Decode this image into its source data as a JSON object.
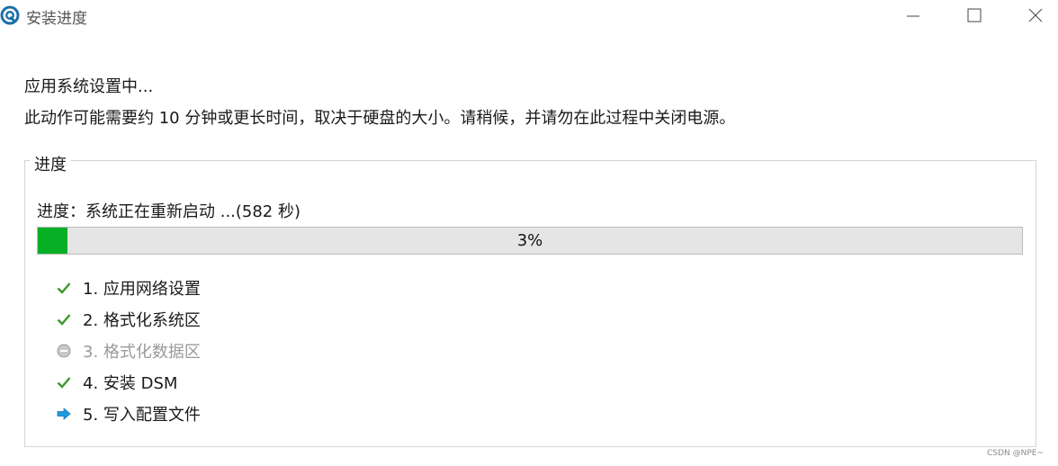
{
  "window": {
    "title": "安装进度",
    "icon": "app-logo-icon"
  },
  "controls": {
    "minimize": "minimize-icon",
    "maximize": "maximize-icon",
    "close": "close-icon"
  },
  "header": {
    "status": "应用系统设置中...",
    "description": "此动作可能需要约 10 分钟或更长时间，取决于硬盘的大小。请稍候，并请勿在此过程中关闭电源。"
  },
  "progress_group": {
    "legend": "进度",
    "label": "进度：系统正在重新启动 ...(582 秒)",
    "percent_text": "3%",
    "percent": 3,
    "fill_color": "#06b025",
    "steps": [
      {
        "label": "1. 应用网络设置",
        "state": "done",
        "icon": "check-icon"
      },
      {
        "label": "2. 格式化系统区",
        "state": "done",
        "icon": "check-icon"
      },
      {
        "label": "3. 格式化数据区",
        "state": "skipped",
        "icon": "skipped-circle-icon"
      },
      {
        "label": "4. 安装 DSM",
        "state": "done",
        "icon": "check-icon"
      },
      {
        "label": "5. 写入配置文件",
        "state": "current",
        "icon": "arrow-right-icon"
      }
    ]
  },
  "watermark": "CSDN @NPE~"
}
